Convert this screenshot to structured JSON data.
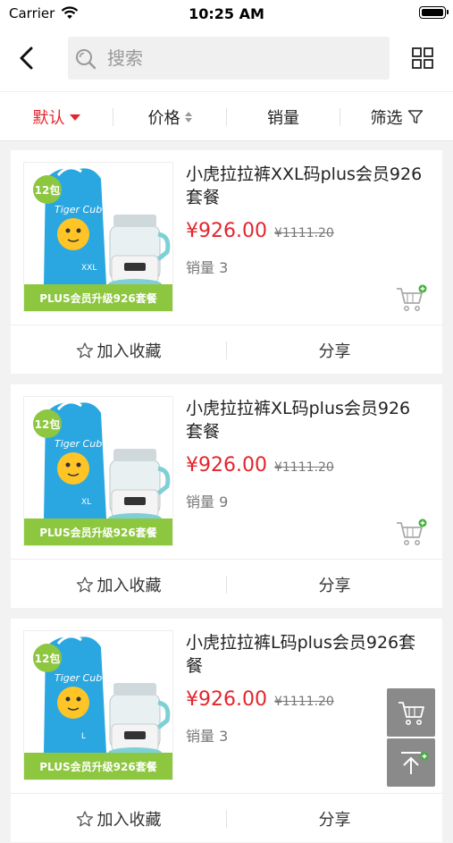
{
  "status_bar": {
    "carrier": "Carrier",
    "time": "10:25 AM"
  },
  "nav": {
    "search_placeholder": "搜索"
  },
  "sort_bar": {
    "items": [
      {
        "label": "默认",
        "active": true
      },
      {
        "label": "价格"
      },
      {
        "label": "销量"
      },
      {
        "label": "筛选"
      }
    ]
  },
  "products": [
    {
      "title": "小虎拉拉裤XXL码plus会员926套餐",
      "price": "¥926.00",
      "original_price": "¥1111.20",
      "sales": "销量 3",
      "image_badge": "12包",
      "image_banner": "PLUS会员升级926套餐",
      "image_brand": "Tiger Cub",
      "image_size": "XXL"
    },
    {
      "title": "小虎拉拉裤XL码plus会员926套餐",
      "price": "¥926.00",
      "original_price": "¥1111.20",
      "sales": "销量 9",
      "image_badge": "12包",
      "image_banner": "PLUS会员升级926套餐",
      "image_brand": "Tiger Cub",
      "image_size": "XL"
    },
    {
      "title": "小虎拉拉裤L码plus会员926套餐",
      "price": "¥926.00",
      "original_price": "¥1111.20",
      "sales": "销量 3",
      "image_badge": "12包",
      "image_banner": "PLUS会员升级926套餐",
      "image_brand": "Tiger Cub",
      "image_size": "L"
    }
  ],
  "actions": {
    "favorite": "加入收藏",
    "share": "分享"
  },
  "colors": {
    "accent_red": "#e3262c",
    "banner_green": "#8dc63f",
    "bag_blue": "#2aa7e0"
  },
  "icons": {
    "back": "chevron-left-icon",
    "search": "search-icon",
    "grid": "grid-icon",
    "filter": "filter-icon",
    "favorite": "star-outline-icon",
    "cart_add": "cart-plus-icon",
    "back_to_top": "back-to-top-icon"
  }
}
